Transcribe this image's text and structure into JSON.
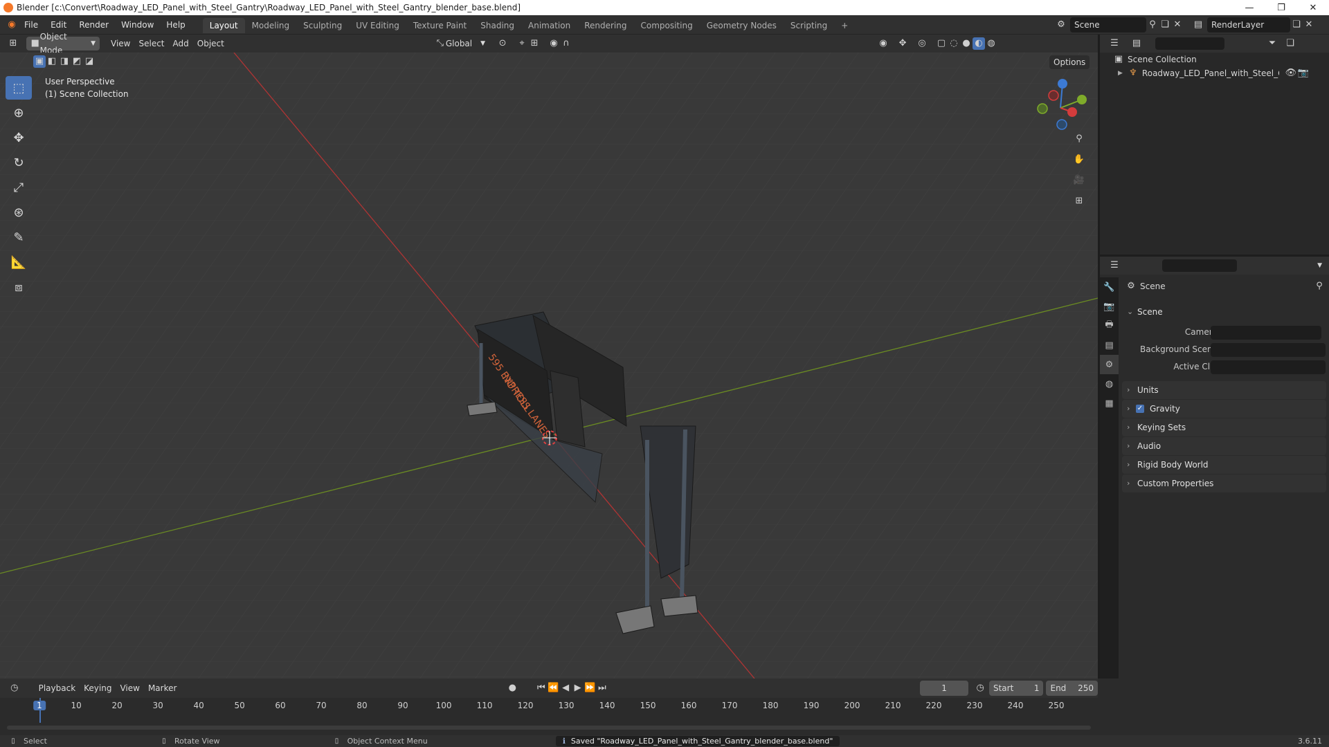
{
  "window": {
    "title": "Blender [c:\\Convert\\Roadway_LED_Panel_with_Steel_Gantry\\Roadway_LED_Panel_with_Steel_Gantry_blender_base.blend]",
    "min": "—",
    "max": "❐",
    "close": "✕"
  },
  "menu": [
    "File",
    "Edit",
    "Render",
    "Window",
    "Help"
  ],
  "workspaces": [
    "Layout",
    "Modeling",
    "Sculpting",
    "UV Editing",
    "Texture Paint",
    "Shading",
    "Animation",
    "Rendering",
    "Compositing",
    "Geometry Nodes",
    "Scripting"
  ],
  "add_workspace": "+",
  "scene_name": "Scene",
  "view_layer": "RenderLayer",
  "viewport": {
    "mode": "Object Mode",
    "menus": [
      "View",
      "Select",
      "Add",
      "Object"
    ],
    "transform_orientation": "Global",
    "options": "Options",
    "perspective_label": "User Perspective",
    "collection_label": "(1) Scene Collection",
    "sign_text": [
      "595 EXPRESS LANES",
      "NO TOLL"
    ]
  },
  "outliner": {
    "root": "Scene Collection",
    "item": "Roadway_LED_Panel_with_Steel_Gantry"
  },
  "properties": {
    "header": "Scene",
    "section": "Scene",
    "fields": [
      {
        "label": "Camera"
      },
      {
        "label": "Background Scene"
      },
      {
        "label": "Active Clip"
      }
    ],
    "panels": [
      "Units",
      "Gravity",
      "Keying Sets",
      "Audio",
      "Rigid Body World",
      "Custom Properties"
    ]
  },
  "timeline": {
    "menus": [
      "Playback",
      "Keying",
      "View",
      "Marker"
    ],
    "current_frame": "1",
    "start_label": "Start",
    "start": "1",
    "end_label": "End",
    "end": "250",
    "ticks": [
      "1",
      "10",
      "20",
      "30",
      "40",
      "50",
      "60",
      "70",
      "80",
      "90",
      "100",
      "110",
      "120",
      "130",
      "140",
      "150",
      "160",
      "170",
      "180",
      "190",
      "200",
      "210",
      "220",
      "230",
      "240",
      "250"
    ]
  },
  "status": {
    "select": "Select",
    "rotate": "Rotate View",
    "context": "Object Context Menu",
    "message": "Saved \"Roadway_LED_Panel_with_Steel_Gantry_blender_base.blend\"",
    "version": "3.6.11"
  },
  "colors": {
    "accent": "#4772b3",
    "x_axis": "#d43c3c",
    "y_axis": "#7fab2a",
    "z_axis": "#3c7ad4"
  }
}
